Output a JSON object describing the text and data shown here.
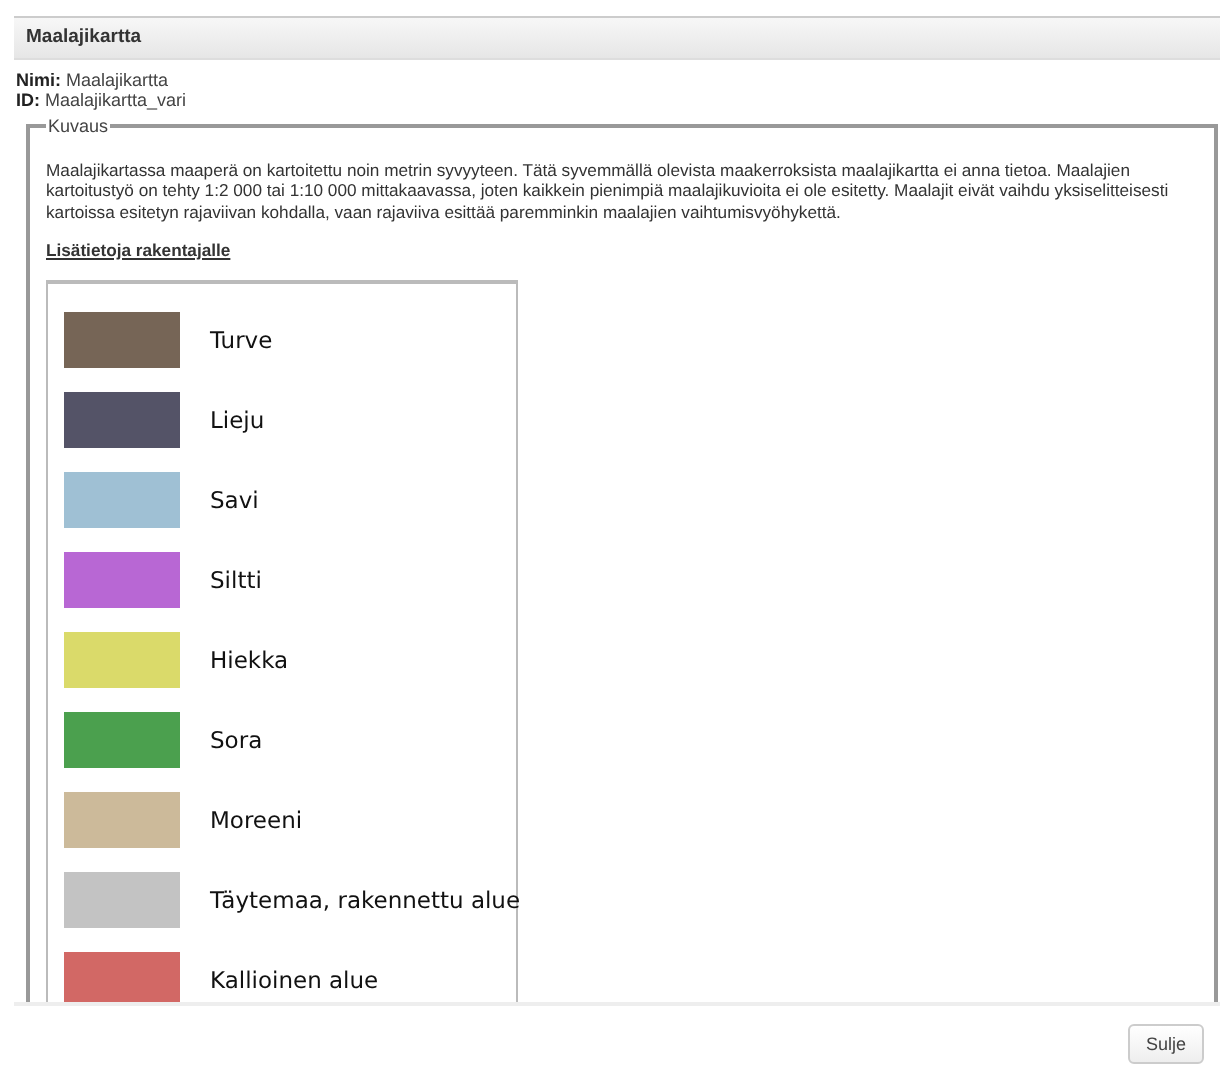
{
  "window": {
    "title": "Maalajikartta"
  },
  "info": [
    {
      "label": "Nimi:",
      "value": "Maalajikartta"
    },
    {
      "label": "ID:",
      "value": "Maalajikartta_vari"
    }
  ],
  "description": {
    "legend": "Kuvaus",
    "text": "Maalajikartassa maaperä on kartoitettu noin metrin syvyyteen. Tätä syvemmällä olevista maakerroksista maalajikartta ei anna tietoa. Maalajien kartoitustyö on tehty 1:2 000 tai 1:10 000 mittakaavassa, joten kaikkein pienimpiä maalajikuvioita ei ole esitetty. Maalajit eivät vaihdu yksiselitteisesti kartoissa esitetyn rajaviivan kohdalla, vaan rajaviiva esittää paremminkin maalajien vaihtumisvyöhykettä.",
    "link": "Lisätietoja rakentajalle"
  },
  "legend_items": [
    {
      "label": "Turve",
      "color": "#766556"
    },
    {
      "label": "Lieju",
      "color": "#545367"
    },
    {
      "label": "Savi",
      "color": "#9fc0d4"
    },
    {
      "label": "Siltti",
      "color": "#b867d4"
    },
    {
      "label": "Hiekka",
      "color": "#dada6a"
    },
    {
      "label": "Sora",
      "color": "#4ba04e"
    },
    {
      "label": "Moreeni",
      "color": "#ccba9a"
    },
    {
      "label": "Täytemaa, rakennettu alue",
      "color": "#c3c3c3"
    },
    {
      "label": "Kallioinen alue",
      "color": "#d26865"
    }
  ],
  "buttons": [
    {
      "label": "Sulje"
    }
  ]
}
